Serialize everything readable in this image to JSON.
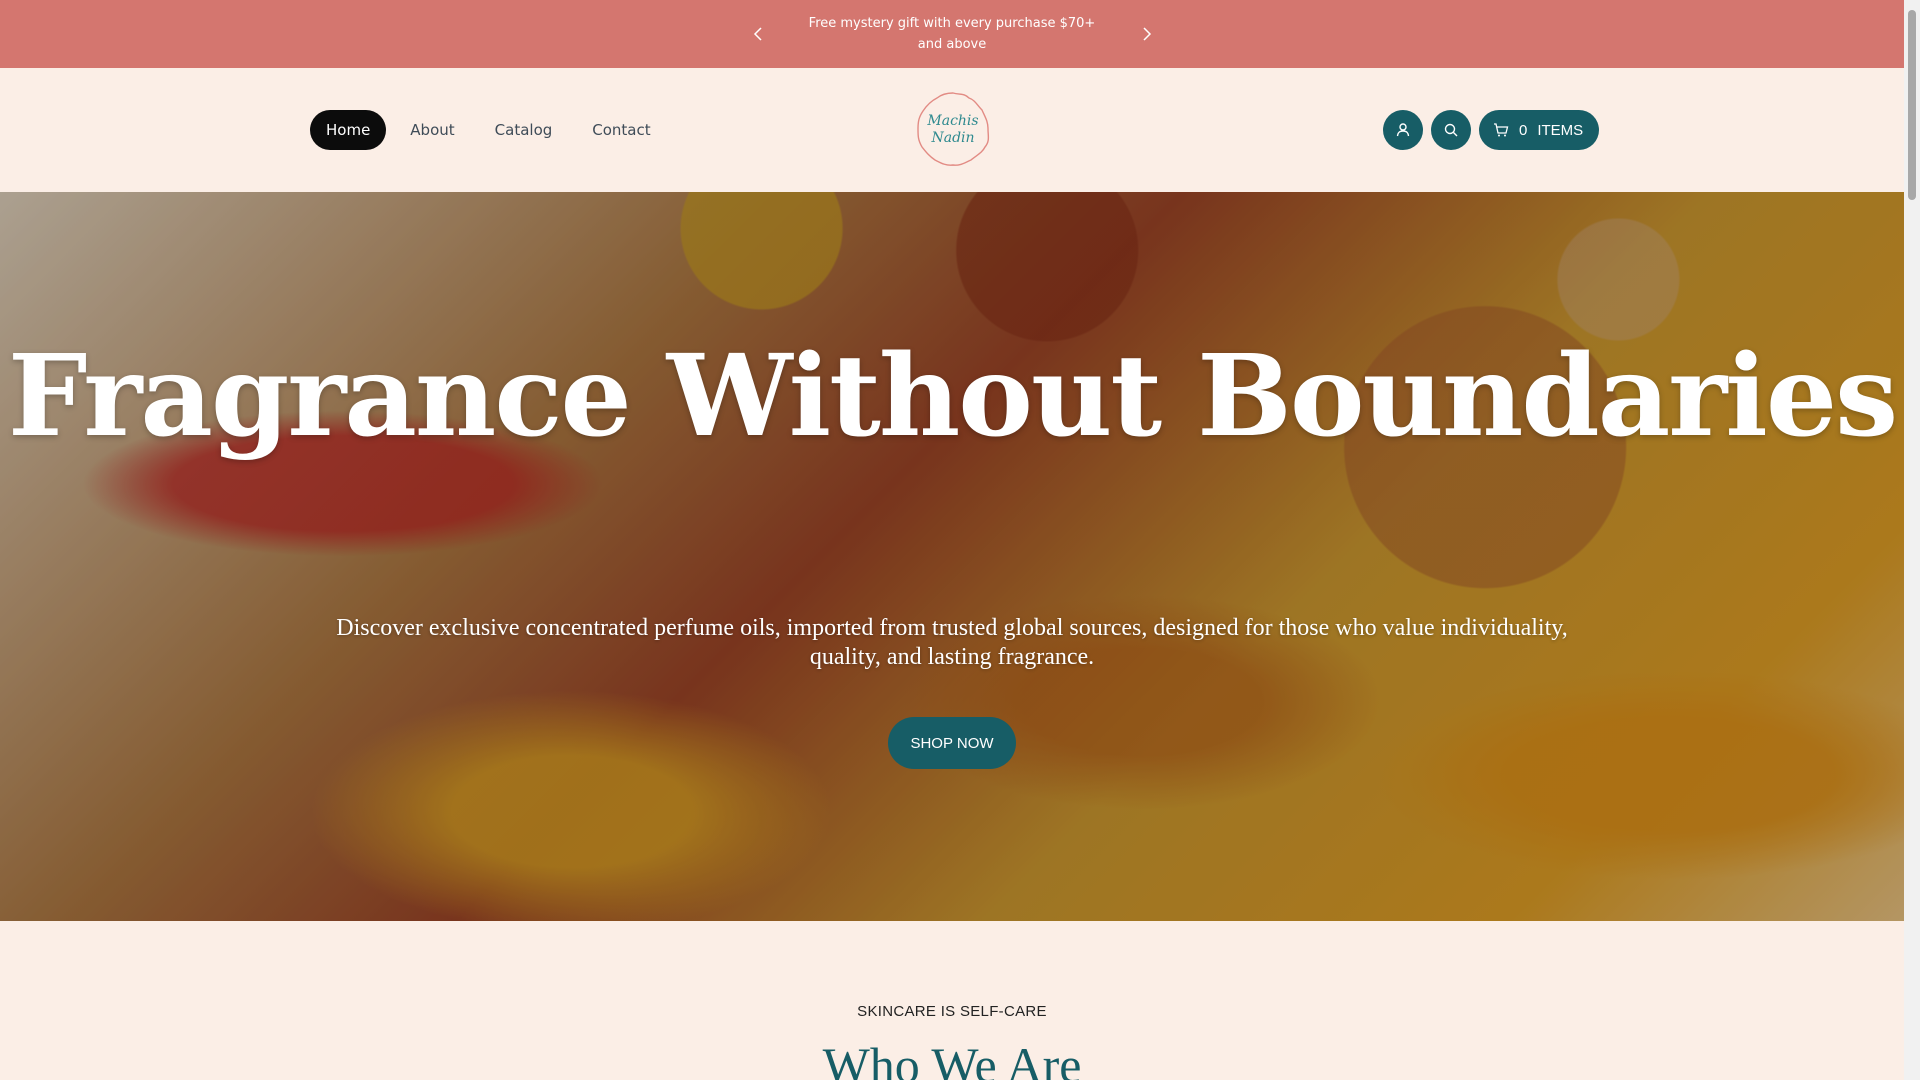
{
  "announcement": {
    "message": "Free mystery gift with every purchase $70+ and above"
  },
  "nav": {
    "items": [
      {
        "label": "Home",
        "active": true
      },
      {
        "label": "About",
        "active": false
      },
      {
        "label": "Catalog",
        "active": false
      },
      {
        "label": "Contact",
        "active": false
      }
    ]
  },
  "logo": {
    "line1": "Machis",
    "line2": "Nadin"
  },
  "cart": {
    "count": "0",
    "label": "ITEMS"
  },
  "hero": {
    "title": "Fragrance Without Boundaries",
    "lead": "Discover exclusive concentrated perfume oils, imported from trusted global sources, designed for those who value individuality, quality, and lasting fragrance.",
    "cta": "SHOP NOW"
  },
  "about": {
    "eyebrow": "SKINCARE IS SELF-CARE",
    "heading": "Who We Are"
  },
  "colors": {
    "announcement_bg": "#d4766f",
    "page_bg": "#fbeee6",
    "accent": "#175d66",
    "nav_active": "#0c0c0c"
  }
}
